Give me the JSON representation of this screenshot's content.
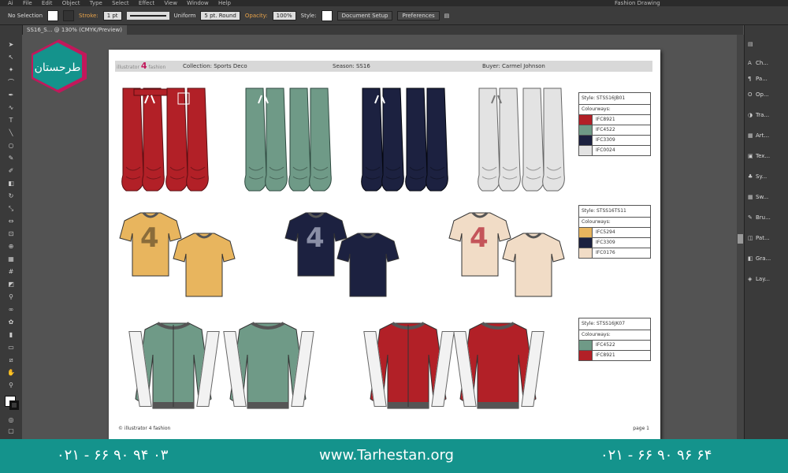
{
  "menubar": {
    "items": [
      "Ai",
      "File",
      "Edit",
      "Object",
      "Type",
      "Select",
      "Effect",
      "View",
      "Window",
      "Help"
    ],
    "workspace": "Fashion Drawing"
  },
  "control_bar": {
    "selection": "No Selection",
    "stroke_label": "Stroke:",
    "stroke_weight": "1 pt",
    "stroke_profile": "Uniform",
    "brush": "5 pt. Round",
    "opacity_label": "Opacity:",
    "opacity_value": "100%",
    "style_label": "Style:",
    "document_setup": "Document Setup",
    "preferences": "Preferences"
  },
  "document_tab": {
    "label": "SS16_S... @ 130% (CMYK/Preview)"
  },
  "right_panel": {
    "items": [
      {
        "icon": "color-icon",
        "label": ""
      },
      {
        "icon": "character-icon",
        "label": "Ch..."
      },
      {
        "icon": "paragraph-icon",
        "label": "Pa..."
      },
      {
        "icon": "opentype-icon",
        "label": "Op..."
      },
      {
        "icon": "transparency-icon",
        "label": "Tra..."
      },
      {
        "icon": "artboards-icon",
        "label": "Art..."
      },
      {
        "icon": "text-icon",
        "label": "Tex..."
      },
      {
        "icon": "symbols-icon",
        "label": "Sy..."
      },
      {
        "icon": "swatches-icon",
        "label": "Sw..."
      },
      {
        "icon": "brushes-icon",
        "label": "Bru..."
      },
      {
        "icon": "pathfinder-icon",
        "label": "Pat..."
      },
      {
        "icon": "graphic-styles-icon",
        "label": "Gra..."
      },
      {
        "icon": "layers-icon",
        "label": "Lay..."
      }
    ]
  },
  "artboard": {
    "logo": {
      "pre": "illustrator",
      "num": "4",
      "post": "fashion"
    },
    "collection": "Collection:  Sports Deco",
    "season": "Season:  SS16",
    "buyer": "Buyer:  Carmel Johnson",
    "footer": "© illustrator 4 fashion",
    "page": "page 1"
  },
  "colorways": [
    {
      "style": "Style:  STSS16JB01",
      "title": "Colourways:",
      "rows": [
        {
          "code": "IFC8921",
          "color": "#b22027"
        },
        {
          "code": "IFC4522",
          "color": "#6f9a87"
        },
        {
          "code": "IFC3309",
          "color": "#1c2140"
        },
        {
          "code": "IFC0024",
          "color": "#e3e3e3"
        }
      ]
    },
    {
      "style": "Style:  STSS16TS11",
      "title": "Colourways:",
      "rows": [
        {
          "code": "IFC5294",
          "color": "#e8b55e"
        },
        {
          "code": "IFC3309",
          "color": "#1c2140"
        },
        {
          "code": "IFC0176",
          "color": "#f1dcc6"
        }
      ]
    },
    {
      "style": "Style:  STSS16JK07",
      "title": "Colourways:",
      "rows": [
        {
          "code": "IFC4522",
          "color": "#6f9a87"
        },
        {
          "code": "IFC8921",
          "color": "#b22027"
        }
      ]
    }
  ],
  "tshirt_number": "4",
  "footer": {
    "phone1": "۰۲۱ - ۶۶ ۹۰ ۹۴ ۰۳",
    "url": "www.Tarhestan.org",
    "phone2": "۰۲۱ - ۶۶ ۹۰ ۹۶ ۶۴"
  },
  "brand": {
    "logo_text": "طرحستان",
    "teal": "#14938c",
    "accent": "#c2185b"
  }
}
